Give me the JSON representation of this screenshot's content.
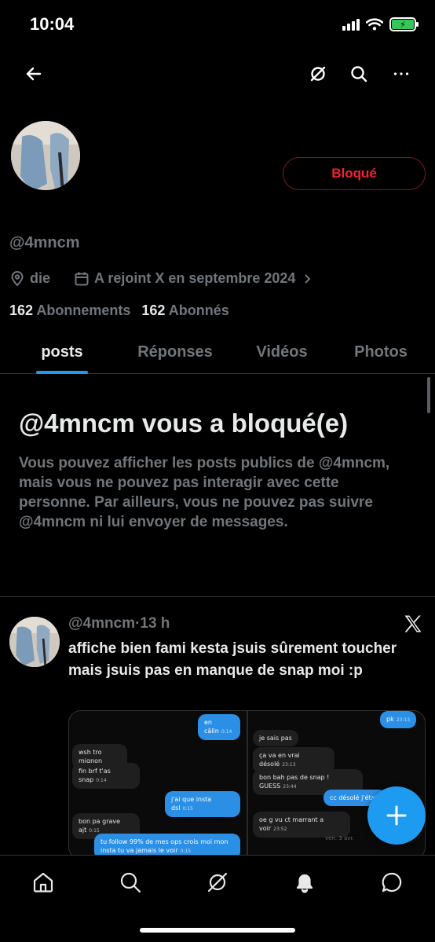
{
  "status_bar": {
    "time": "10:04",
    "battery_icon": "battery-charging-icon"
  },
  "nav": {
    "back_icon": "back-arrow-icon",
    "grok_icon": "grok-icon",
    "search_icon": "search-icon",
    "more_icon": "more-icon"
  },
  "profile": {
    "blocked_label": "Bloqué",
    "handle": "@4mncm",
    "location": "die",
    "joined": "A rejoint X en septembre 2024",
    "following_count": "162",
    "following_label": "Abonnements",
    "followers_count": "162",
    "followers_label": "Abonnés"
  },
  "tabs": [
    {
      "label": "posts"
    },
    {
      "label": "Réponses"
    },
    {
      "label": "Vidéos"
    },
    {
      "label": "Photos"
    }
  ],
  "active_tab": "posts",
  "notice": {
    "title": "@4mncm vous a bloqué(e)",
    "body": "Vous pouvez afficher les posts publics de @4mncm, mais vous ne pouvez pas interagir avec cette personne. Par ailleurs, vous ne pouvez pas suivre @4mncm ni lui envoyer de messages."
  },
  "post": {
    "handle": "@4mncm",
    "separator": "·",
    "time": "13 h",
    "text": "affiche bien fami kesta jsuis sûrement toucher mais jsuis pas en manque de snap moi :p",
    "media_left": [
      {
        "text": "en câlin",
        "time": "0:14",
        "dir": "out"
      },
      {
        "text": "wsh tro mignon",
        "time": "",
        "dir": "in"
      },
      {
        "text": "fin brf t'as snap",
        "time": "0:14",
        "dir": "in"
      },
      {
        "text": "j'ai que insta dsl",
        "time": "0:15",
        "dir": "out"
      },
      {
        "text": "bon pa grave ajt",
        "time": "0:15",
        "dir": "in"
      },
      {
        "text": "tu follow 99% de mes ops crois moi mon insta tu va jamais le voir",
        "time": "0:15",
        "dir": "out"
      }
    ],
    "media_right": [
      {
        "text": "pk",
        "time": "23:13",
        "dir": "out"
      },
      {
        "text": "je sais pas",
        "time": "",
        "dir": "in"
      },
      {
        "text": "ça va en vrai désolé",
        "time": "23:13",
        "dir": "in"
      },
      {
        "text": "bon bah pas de snap ! GUESS",
        "time": "23:44",
        "dir": "in"
      },
      {
        "text": "cc désolé j'étais",
        "time": "",
        "dir": "out"
      },
      {
        "text": "oe g vu ct marrant a voir",
        "time": "23:52",
        "dir": "in"
      }
    ],
    "media_note": "ven. 3 avr."
  },
  "bottom_nav": [
    {
      "name": "home-icon"
    },
    {
      "name": "search-icon"
    },
    {
      "name": "grok-icon"
    },
    {
      "name": "notifications-icon"
    },
    {
      "name": "messages-icon"
    }
  ],
  "colors": {
    "accent": "#1d9bf0",
    "blocked": "#f4212e",
    "muted": "#71767b",
    "text": "#e7e9ea",
    "bg": "#000000"
  }
}
